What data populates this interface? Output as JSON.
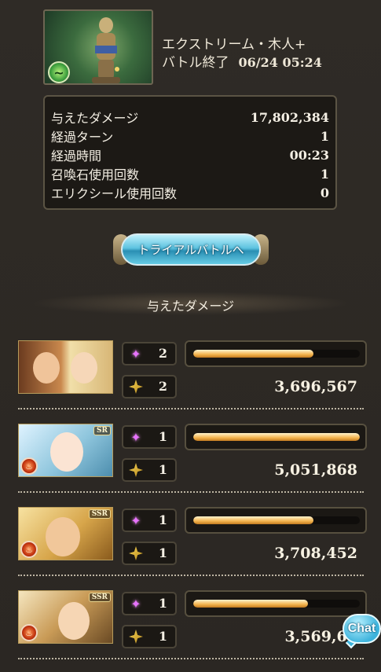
{
  "quest": {
    "title": "エクストリーム・木人+",
    "status": "バトル終了",
    "timestamp": "06/24 05:24",
    "thumbnail_icon": "wooden-dummy-statue-icon",
    "element_icon": "wind-element-icon"
  },
  "stats": [
    {
      "label": "与えたダメージ",
      "value": "17,802,384"
    },
    {
      "label": "経過ターン",
      "value": "1"
    },
    {
      "label": "経過時間",
      "value": "00:23"
    },
    {
      "label": "召喚石使用回数",
      "value": "1"
    },
    {
      "label": "エリクシール使用回数",
      "value": "0"
    }
  ],
  "trial_button": {
    "label": "トライアルバトルへ"
  },
  "section": {
    "title": "与えたダメージ"
  },
  "characters": [
    {
      "rarity": "",
      "element": "",
      "skill_count": "2",
      "ougi_count": "2",
      "damage": "3,696,567",
      "bar_fill": 0.72,
      "element_color": ""
    },
    {
      "rarity": "SR",
      "element": "fire",
      "skill_count": "1",
      "ougi_count": "1",
      "damage": "5,051,868",
      "bar_fill": 1.0,
      "element_color": "#d7401a"
    },
    {
      "rarity": "SSR",
      "element": "fire",
      "skill_count": "1",
      "ougi_count": "1",
      "damage": "3,708,452",
      "bar_fill": 0.72,
      "element_color": "#d7401a"
    },
    {
      "rarity": "SSR",
      "element": "fire",
      "skill_count": "1",
      "ougi_count": "1",
      "damage": "3,569,60",
      "bar_fill": 0.69,
      "element_color": "#d7401a"
    }
  ],
  "chat": {
    "label": "Chat"
  },
  "colors": {
    "background": "#2e2a25",
    "bar_fill": "#f3b34d",
    "trial_button": "#5dc3e0"
  }
}
